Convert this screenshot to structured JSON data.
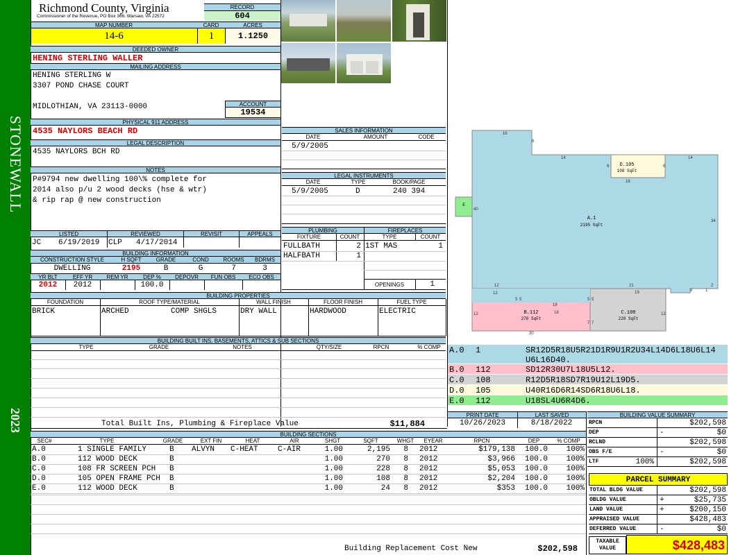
{
  "sidebar": {
    "district": "STONEWALL",
    "year": "2023"
  },
  "header": {
    "county": "Richmond County, Virginia",
    "commissioner": "Commissioner of the Revenue, PO Box 366, Warsaw, VA 22572",
    "record_label": "RECORD",
    "record": "604",
    "map_label": "MAP NUMBER",
    "map": "14-6",
    "card_label": "CARD",
    "card": "1",
    "acres_label": "ACRES",
    "acres": "1.1250"
  },
  "owner": {
    "deeded_label": "DEEDED OWNER",
    "deeded": "HENING STERLING WALLER",
    "mailing_label": "MAILING ADDRESS",
    "line1": "HENING STERLING W",
    "line2": "3307 POND CHASE COURT",
    "line3": "MIDLOTHIAN, VA 23113-0000",
    "account_label": "ACCOUNT",
    "account": "19534"
  },
  "address": {
    "label": "PHYSICAL 911 ADDRESS",
    "value": "4535 NAYLORS BEACH RD"
  },
  "legal": {
    "label": "LEGAL DESCRIPTION",
    "value": "4535 NAYLORS BCH RD"
  },
  "notes": {
    "label": "NOTES",
    "line1": "P#9794 new dwelling 100\\% complete for",
    "line2": "2014 also p/u 2 wood decks (hse & wtr)",
    "line3": "& rip rap @ new construction"
  },
  "sales": {
    "title": "SALES INFORMATION",
    "cols": [
      "DATE",
      "AMOUNT",
      "CODE"
    ],
    "date": "5/9/2005"
  },
  "instruments": {
    "title": "LEGAL INSTRUMENTS",
    "cols": [
      "DATE",
      "TYPE",
      "BOOK/PAGE"
    ],
    "date": "5/9/2005",
    "type": "D",
    "book": "240 394"
  },
  "review": {
    "listed_label": "LISTED",
    "reviewed_label": "REVIEWED",
    "revisit_label": "REVISIT",
    "appeals_label": "APPEALS",
    "listed_by": "JC",
    "listed_date": "6/19/2019",
    "reviewed_by": "CLP",
    "reviewed_date": "4/17/2014"
  },
  "plumbing": {
    "title": "PLUMBING",
    "fixture_label": "FIXTURE",
    "count_label": "COUNT",
    "rows": [
      {
        "name": "FULLBATH",
        "count": "2"
      },
      {
        "name": "HALFBATH",
        "count": "1"
      }
    ]
  },
  "fireplaces": {
    "title": "FIREPLACES",
    "type_label": "TYPE",
    "count_label": "COUNT",
    "type": "1ST MAS",
    "count": "1",
    "openings_label": "OPENINGS",
    "openings": "1"
  },
  "building_info": {
    "title": "BUILDING INFORMATION",
    "cols": [
      "CONSTRUCTION STYLE",
      "H SQFT",
      "GRADE",
      "COND",
      "ROOMS",
      "BDRMS"
    ],
    "style": "DWELLING",
    "hsqft": "2195",
    "grade": "B",
    "cond": "G",
    "rooms": "7",
    "bdrms": "3",
    "cols2": [
      "YR BLT",
      "EFF YR",
      "REM YR",
      "DEP %",
      "DEPOVR",
      "FUN OBS",
      "ECO OBS"
    ],
    "yrblt": "2012",
    "effyr": "2012",
    "dep": "100.0"
  },
  "properties": {
    "title": "BUILDING PROPERTIES",
    "cols": [
      "FOUNDATION",
      "ROOF TYPE/MATERIAL",
      "WALL FINISH",
      "FLOOR FINISH",
      "FUEL TYPE"
    ],
    "foundation": "BRICK",
    "roof1": "ARCHED",
    "roof2": "COMP SHGLS",
    "wall": "DRY WALL",
    "floor": "HARDWOOD",
    "fuel": "ELECTRIC"
  },
  "builtins": {
    "title": "BUILDING BUILT INS, BASEMENTS, ATTICS & SUB SECTIONS",
    "cols": [
      "TYPE",
      "GRADE",
      "NOTES",
      "QTY/SIZE",
      "RPCN",
      "% COMP"
    ],
    "total_label": "Total Built Ins, Plumbing & Fireplace Value",
    "total": "$11,884"
  },
  "sections": {
    "title": "BUILDING SECTIONS",
    "cols": [
      "SEC#",
      "TYPE",
      "GRADE",
      "EXT FIN",
      "HEAT",
      "AIR",
      "SHGT",
      "SQFT",
      "WHGT",
      "EYEAR",
      "RPCN",
      "DEP",
      "% COMP"
    ],
    "rows": [
      {
        "sec": "A.0",
        "type": "1 SINGLE FAMILY",
        "grade": "B",
        "ext": "ALVYN",
        "heat": "C-HEAT",
        "air": "C-AIR",
        "shgt": "1.00",
        "sqft": "2,195",
        "whgt": "8",
        "eyear": "2012",
        "rpcn": "$179,138",
        "dep": "100.0",
        "comp": "100%"
      },
      {
        "sec": "B.0",
        "type": "112 WOOD DECK",
        "grade": "B",
        "ext": "",
        "heat": "",
        "air": "",
        "shgt": "1.00",
        "sqft": "270",
        "whgt": "8",
        "eyear": "2012",
        "rpcn": "$3,966",
        "dep": "100.0",
        "comp": "100%"
      },
      {
        "sec": "C.0",
        "type": "108 FR SCREEN PCH",
        "grade": "B",
        "ext": "",
        "heat": "",
        "air": "",
        "shgt": "1.00",
        "sqft": "228",
        "whgt": "8",
        "eyear": "2012",
        "rpcn": "$5,053",
        "dep": "100.0",
        "comp": "100%"
      },
      {
        "sec": "D.0",
        "type": "105 OPEN FRAME PCH",
        "grade": "B",
        "ext": "",
        "heat": "",
        "air": "",
        "shgt": "1.00",
        "sqft": "108",
        "whgt": "8",
        "eyear": "2012",
        "rpcn": "$2,204",
        "dep": "100.0",
        "comp": "100%"
      },
      {
        "sec": "E.0",
        "type": "112 WOOD DECK",
        "grade": "B",
        "ext": "",
        "heat": "",
        "air": "",
        "shgt": "1.00",
        "sqft": "24",
        "whgt": "8",
        "eyear": "2012",
        "rpcn": "$353",
        "dep": "100.0",
        "comp": "100%"
      }
    ],
    "replacement_label": "Building Replacement Cost New",
    "replacement": "$202,598"
  },
  "sketch": {
    "labels": {
      "a": "A.1",
      "a_area": "2195 SqFt",
      "b": "B.112",
      "b_area": "270 SqFt",
      "c": "C.108",
      "c_area": "228 SqFt",
      "d": "D.105",
      "d_area": "108 SqFt",
      "e": "E"
    },
    "dims": [
      "16",
      "6",
      "14",
      "6",
      "6",
      "14",
      "18",
      "40",
      "34",
      "12",
      "5",
      "5",
      "18",
      "12",
      "7",
      "7",
      "30",
      "21",
      "19",
      "12",
      "9",
      "2",
      "1",
      "5",
      "5",
      "18",
      "1"
    ],
    "codes": [
      {
        "sec": "A.0",
        "code": "1",
        "text": "SR12D5R18U5R21D1R9U1R2U34L14D6L18U6L14",
        "text2": "U6L16D40.",
        "color": "#add8e6"
      },
      {
        "sec": "B.0",
        "code": "112",
        "text": "SD12R30U7L18U5L12.",
        "color": "#ffc0cb"
      },
      {
        "sec": "C.0",
        "code": "108",
        "text": "R12D5R18SD7R19U12L19D5.",
        "color": "#d3d3d3"
      },
      {
        "sec": "D.0",
        "code": "105",
        "text": "U40R16D6R14SD6R18U6L18.",
        "color": "#fffadc"
      },
      {
        "sec": "E.0",
        "code": "112",
        "text": "U18SL4U6R4D6.",
        "color": "#90ee90"
      }
    ]
  },
  "dates": {
    "print_label": "PRINT DATE",
    "print": "10/26/2023",
    "saved_label": "LAST SAVED",
    "saved": "8/18/2022"
  },
  "value_summary": {
    "title": "BUILDING VALUE SUMMARY",
    "rows": [
      {
        "label": "RPCN",
        "sign": "",
        "pct": "",
        "value": "$202,598"
      },
      {
        "label": "DEP",
        "sign": "-",
        "pct": "",
        "value": "$0"
      },
      {
        "label": "RCLND",
        "sign": "",
        "pct": "",
        "value": "$202,598"
      },
      {
        "label": "OBS F/E",
        "sign": "-",
        "pct": "",
        "value": "$0"
      },
      {
        "label": "LTF",
        "sign": "",
        "pct": "100%",
        "value": "$202,598"
      }
    ]
  },
  "parcel": {
    "title": "PARCEL SUMMARY",
    "rows": [
      {
        "label": "TOTAL BLDG VALUE",
        "sign": "",
        "value": "$202,598"
      },
      {
        "label": "OBLDG VALUE",
        "sign": "+",
        "value": "$25,735"
      },
      {
        "label": "LAND VALUE",
        "sign": "+",
        "value": "$200,150"
      },
      {
        "label": "APPRAISED VALUE",
        "sign": "",
        "value": "$428,483"
      },
      {
        "label": "DEFERRED VALUE",
        "sign": "-",
        "value": "$0"
      }
    ],
    "taxable_label1": "TAXABLE",
    "taxable_label2": "VALUE",
    "taxable": "$428,483"
  },
  "photos": [
    "house-photo-1",
    "house-photo-2",
    "shed-photo",
    "house-photo-3",
    "garage-photo"
  ]
}
